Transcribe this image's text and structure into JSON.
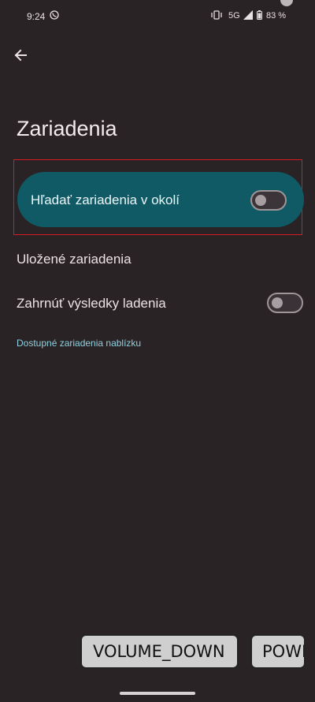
{
  "status_bar": {
    "time": "9:24",
    "network": "5G",
    "battery": "83 %",
    "icons": [
      "viber-icon",
      "vibrate-icon",
      "signal-icon",
      "battery-icon"
    ]
  },
  "header": {
    "back_icon": "arrow-left-icon",
    "title": "Zariadenia"
  },
  "main_toggle": {
    "label": "Hľadať zariadenia v okolí",
    "enabled": false
  },
  "items": [
    {
      "label": "Uložené zariadenia"
    },
    {
      "label": "Zahrnúť výsledky ladenia",
      "enabled": false
    }
  ],
  "section_link": "Dostupné zariadenia nablízku",
  "overlay_buttons": {
    "volume_down": "VOLUME_DOWN",
    "power": "POWER"
  },
  "colors": {
    "background": "#2a2326",
    "card": "#0f5a65",
    "accent_link": "#8fd0e0",
    "highlight": "#d51b25"
  }
}
